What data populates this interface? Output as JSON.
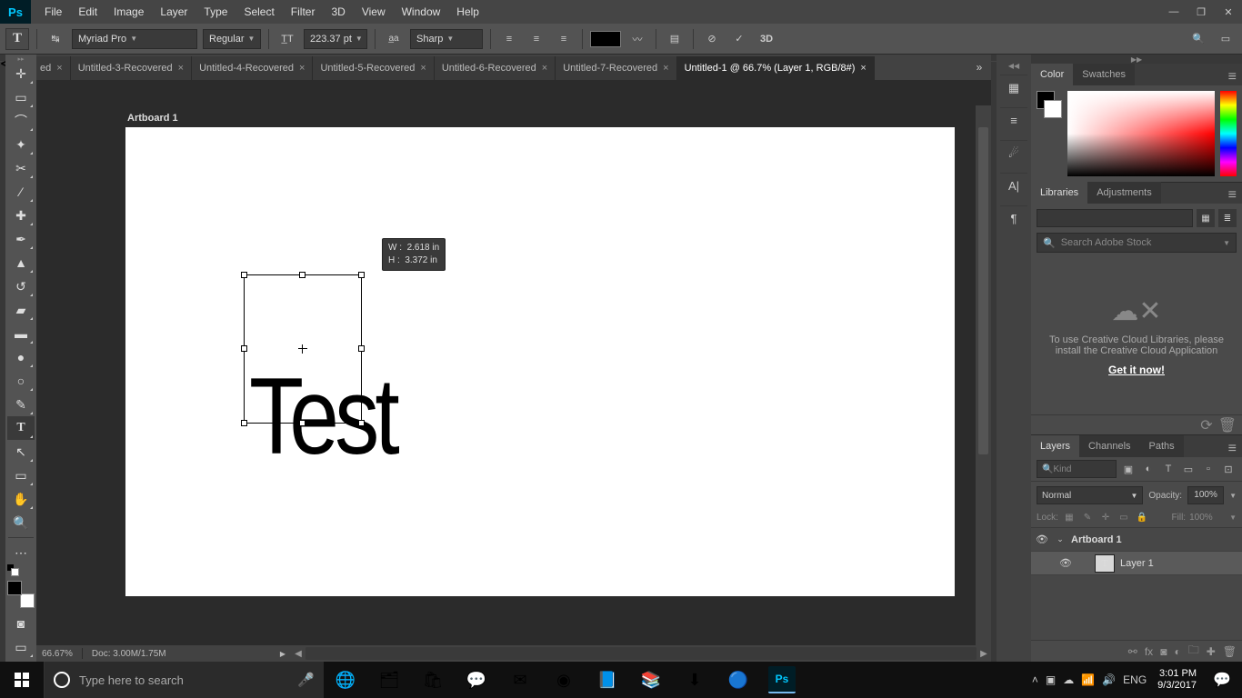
{
  "app": {
    "logo": "Ps"
  },
  "menu": [
    "File",
    "Edit",
    "Image",
    "Layer",
    "Type",
    "Select",
    "Filter",
    "3D",
    "View",
    "Window",
    "Help"
  ],
  "options": {
    "font_family": "Myriad Pro",
    "font_style": "Regular",
    "font_size": "223.37 pt",
    "antialias": "Sharp",
    "3d_label": "3D"
  },
  "tabs": [
    {
      "label": "ed",
      "cut": true
    },
    {
      "label": "Untitled-3-Recovered"
    },
    {
      "label": "Untitled-4-Recovered"
    },
    {
      "label": "Untitled-5-Recovered"
    },
    {
      "label": "Untitled-6-Recovered"
    },
    {
      "label": "Untitled-7-Recovered"
    },
    {
      "label": "Untitled-1 @ 66.7% (Layer 1, RGB/8#)",
      "active": true
    }
  ],
  "artboard": {
    "label": "Artboard 1",
    "text_content": "Test",
    "tooltip_w_label": "W :",
    "tooltip_w_value": "2.618 in",
    "tooltip_h_label": "H :",
    "tooltip_h_value": "3.372 in"
  },
  "status": {
    "zoom": "66.67%",
    "doc": "Doc: 3.00M/1.75M"
  },
  "panels": {
    "color_tab": "Color",
    "swatches_tab": "Swatches",
    "libraries_tab": "Libraries",
    "adjustments_tab": "Adjustments",
    "libraries_search_placeholder": "Search Adobe Stock",
    "libraries_msg": "To use Creative Cloud Libraries, please install the Creative Cloud Application",
    "libraries_link": "Get it now!",
    "layers_tab": "Layers",
    "channels_tab": "Channels",
    "paths_tab": "Paths",
    "layers_kind": "Kind",
    "layers_blend": "Normal",
    "layers_opacity_label": "Opacity:",
    "layers_opacity": "100%",
    "layers_lock_label": "Lock:",
    "layers_fill_label": "Fill:",
    "layers_fill": "100%",
    "layer0": "Artboard 1",
    "layer1": "Layer 1"
  },
  "taskbar": {
    "search_placeholder": "Type here to search",
    "lang": "ENG",
    "time": "3:01 PM",
    "date": "9/3/2017"
  }
}
